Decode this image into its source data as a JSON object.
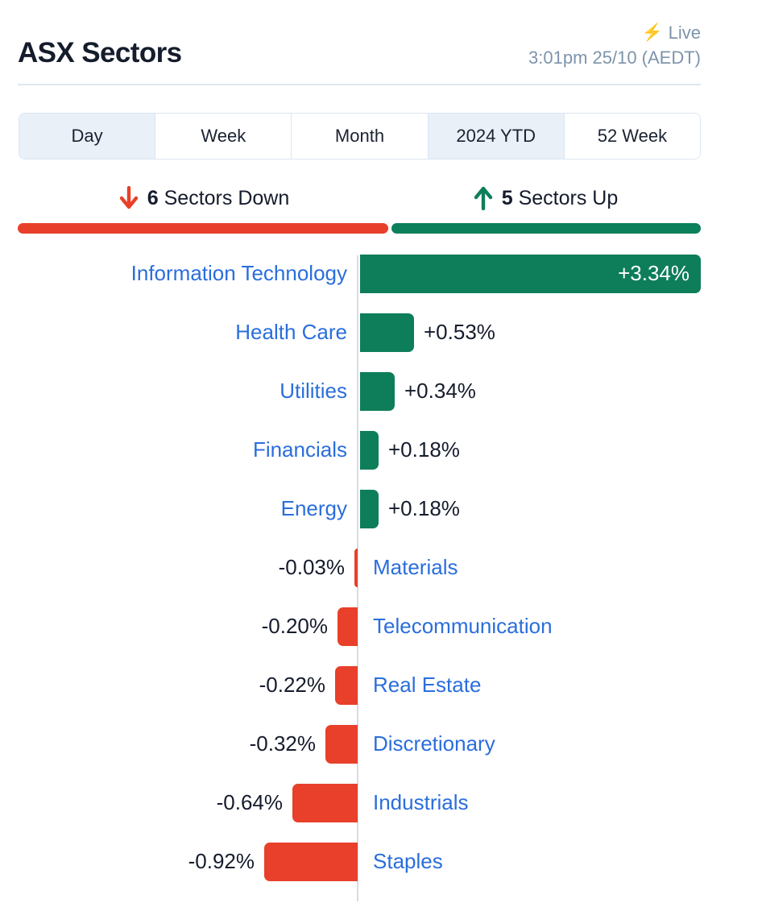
{
  "header": {
    "title": "ASX Sectors",
    "live_label": "Live",
    "bolt_icon": "bolt-icon",
    "timestamp": "3:01pm 25/10 (AEDT)"
  },
  "tabs": {
    "items": [
      {
        "label": "Day",
        "active": true
      },
      {
        "label": "Week",
        "active": false
      },
      {
        "label": "Month",
        "active": false
      },
      {
        "label": "2024 YTD",
        "active": true
      },
      {
        "label": "52 Week",
        "active": false
      }
    ]
  },
  "summary": {
    "down": {
      "count": "6",
      "text": " Sectors Down",
      "icon": "arrow-down-icon",
      "color": "#e8402a",
      "share": 0.545
    },
    "up": {
      "count": "5",
      "text": " Sectors Up",
      "icon": "arrow-up-icon",
      "color": "#0c7f5b",
      "share": 0.455
    }
  },
  "colors": {
    "positive": "#0e7d5a",
    "negative": "#e8402a",
    "link": "#2a6edc",
    "text": "#151c2c",
    "muted": "#7e94ab",
    "axis": "#d8dce2"
  },
  "chart_data": {
    "type": "bar",
    "orientation": "horizontal-diverging",
    "title": "ASX Sectors",
    "xlabel": "",
    "ylabel": "",
    "unit": "%",
    "period": "Day",
    "zero_axis": true,
    "grid": false,
    "legend": null,
    "xlim": [
      -1.0,
      3.5
    ],
    "categories": [
      "Information Technology",
      "Health Care",
      "Utilities",
      "Financials",
      "Energy",
      "Materials",
      "Telecommunication",
      "Real Estate",
      "Discretionary",
      "Industrials",
      "Staples"
    ],
    "values": [
      3.34,
      0.53,
      0.34,
      0.18,
      0.18,
      -0.03,
      -0.2,
      -0.22,
      -0.32,
      -0.64,
      -0.92
    ],
    "labels": [
      "+3.34%",
      "+0.53%",
      "+0.34%",
      "+0.18%",
      "+0.18%",
      "-0.03%",
      "-0.20%",
      "-0.22%",
      "-0.32%",
      "-0.64%",
      "-0.92%"
    ],
    "rows": [
      {
        "name": "Information Technology",
        "value": 3.34,
        "label": "+3.34%",
        "sign": "pos",
        "label_inside": true
      },
      {
        "name": "Health Care",
        "value": 0.53,
        "label": "+0.53%",
        "sign": "pos",
        "label_inside": false
      },
      {
        "name": "Utilities",
        "value": 0.34,
        "label": "+0.34%",
        "sign": "pos",
        "label_inside": false
      },
      {
        "name": "Financials",
        "value": 0.18,
        "label": "+0.18%",
        "sign": "pos",
        "label_inside": false
      },
      {
        "name": "Energy",
        "value": 0.18,
        "label": "+0.18%",
        "sign": "pos",
        "label_inside": false
      },
      {
        "name": "Materials",
        "value": -0.03,
        "label": "-0.03%",
        "sign": "neg",
        "label_inside": false
      },
      {
        "name": "Telecommunication",
        "value": -0.2,
        "label": "-0.20%",
        "sign": "neg",
        "label_inside": false
      },
      {
        "name": "Real Estate",
        "value": -0.22,
        "label": "-0.22%",
        "sign": "neg",
        "label_inside": false
      },
      {
        "name": "Discretionary",
        "value": -0.32,
        "label": "-0.32%",
        "sign": "neg",
        "label_inside": false
      },
      {
        "name": "Industrials",
        "value": -0.64,
        "label": "-0.64%",
        "sign": "neg",
        "label_inside": false
      },
      {
        "name": "Staples",
        "value": -0.92,
        "label": "-0.92%",
        "sign": "neg",
        "label_inside": false
      }
    ],
    "sectors_up": 5,
    "sectors_down": 6
  }
}
